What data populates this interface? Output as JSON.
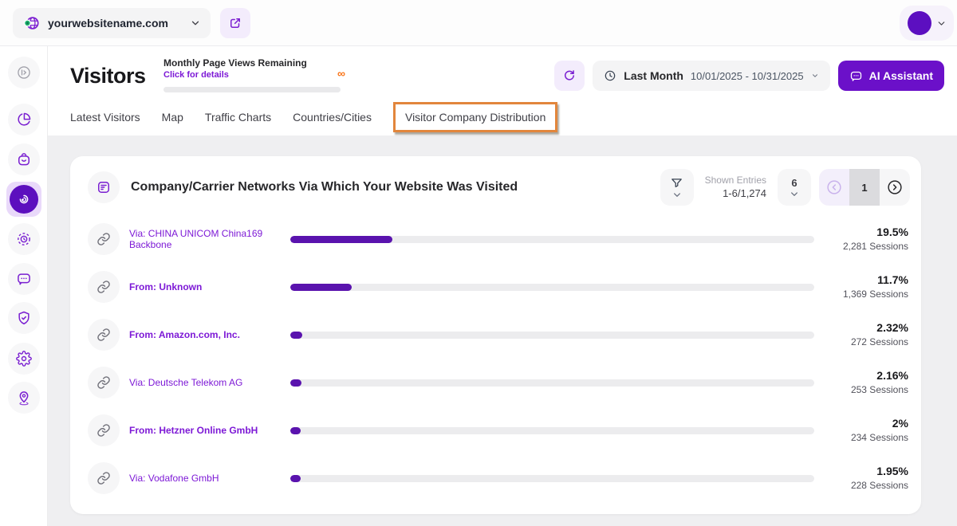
{
  "topbar": {
    "site_name": "yourwebsitename.com"
  },
  "header": {
    "title": "Visitors",
    "quota": {
      "label": "Monthly Page Views Remaining",
      "link": "Click for details",
      "value": "∞"
    },
    "period": {
      "label": "Last Month",
      "range": "10/01/2025 - 10/31/2025"
    },
    "ai_assistant_label": "AI Assistant"
  },
  "tabs": [
    {
      "label": "Latest Visitors",
      "highlighted": false
    },
    {
      "label": "Map",
      "highlighted": false
    },
    {
      "label": "Traffic Charts",
      "highlighted": false
    },
    {
      "label": "Countries/Cities",
      "highlighted": false
    },
    {
      "label": "Visitor Company Distribution",
      "highlighted": true
    }
  ],
  "sidebar": {
    "items": [
      {
        "icon": "collapse-sidebar-icon",
        "active": false
      },
      {
        "icon": "pie-chart-icon",
        "active": false
      },
      {
        "icon": "shopping-bag-icon",
        "active": false
      },
      {
        "icon": "radar-visitors-icon",
        "active": true
      },
      {
        "icon": "session-timer-icon",
        "active": false
      },
      {
        "icon": "chat-bubble-icon",
        "active": false
      },
      {
        "icon": "shield-check-icon",
        "active": false
      },
      {
        "icon": "gear-icon",
        "active": false
      },
      {
        "icon": "location-pin-icon",
        "active": false
      }
    ]
  },
  "card": {
    "title": "Company/Carrier Networks Via Which Your Website Was Visited",
    "shown_entries_label": "Shown Entries",
    "shown_entries_value": "1-6/1,274",
    "page_size": "6",
    "current_page": "1",
    "rows": [
      {
        "label": "Via: CHINA UNICOM China169 Backbone",
        "bold": false,
        "percent": "19.5%",
        "sessions": "2,281 Sessions",
        "bar_percent": 19.5
      },
      {
        "label": "From: Unknown",
        "bold": true,
        "percent": "11.7%",
        "sessions": "1,369 Sessions",
        "bar_percent": 11.7
      },
      {
        "label": "From: Amazon.com, Inc.",
        "bold": true,
        "percent": "2.32%",
        "sessions": "272 Sessions",
        "bar_percent": 2.32
      },
      {
        "label": "Via: Deutsche Telekom AG",
        "bold": false,
        "percent": "2.16%",
        "sessions": "253 Sessions",
        "bar_percent": 2.16
      },
      {
        "label": "From: Hetzner Online GmbH",
        "bold": true,
        "percent": "2%",
        "sessions": "234 Sessions",
        "bar_percent": 2.0
      },
      {
        "label": "Via: Vodafone GmbH",
        "bold": false,
        "percent": "1.95%",
        "sessions": "228 Sessions",
        "bar_percent": 1.95
      }
    ]
  },
  "colors": {
    "primary_purple": "#6b10c9",
    "bar_purple": "#5a13ae",
    "label_purple": "#7d19d6",
    "highlight_orange": "#e2863c",
    "infinity_orange": "#f97316",
    "content_bg": "#efeff1"
  }
}
